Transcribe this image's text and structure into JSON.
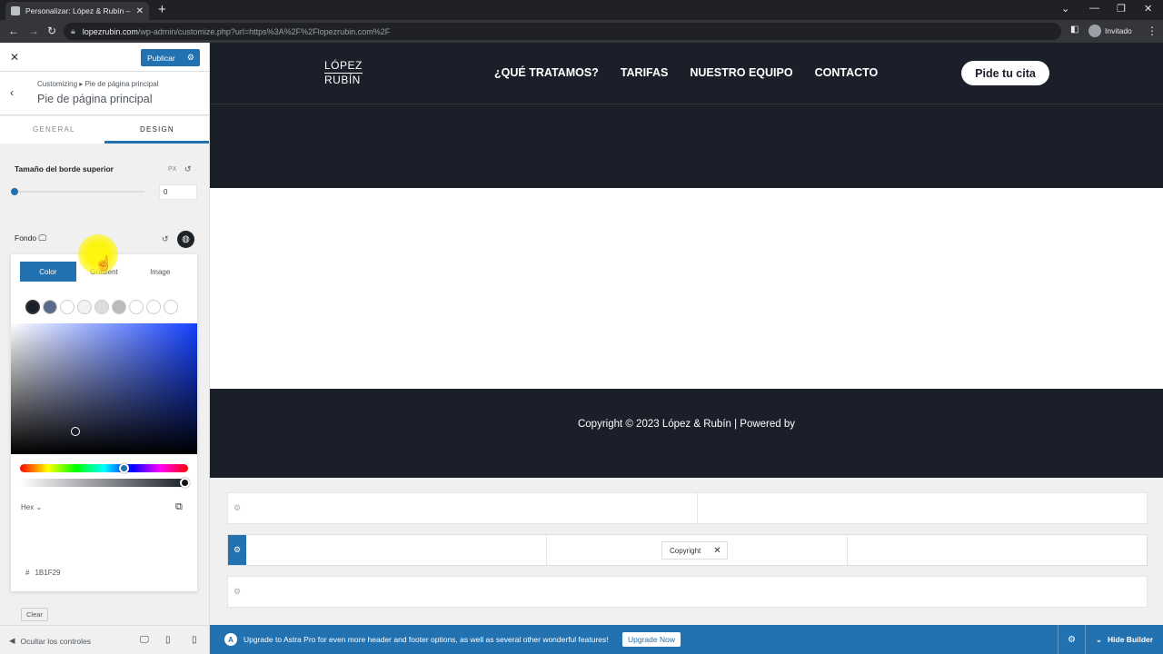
{
  "browser": {
    "tab_title": "Personalizar: López & Rubín – Ca",
    "url_host": "lopezrubin.com",
    "url_path": "/wp-admin/customize.php?url=https%3A%2F%2Flopezrubin.com%2F",
    "profile_label": "Invitado"
  },
  "customizer": {
    "publish_label": "Publicar",
    "breadcrumb": "Customizing  ▸  Pie de página principal",
    "section_title": "Pie de página principal",
    "tabs": [
      {
        "label": "GENERAL"
      },
      {
        "label": "DESIGN"
      }
    ],
    "active_tab": "DESIGN",
    "border_size": {
      "label": "Tamaño del borde superior",
      "unit": "PX",
      "value": "0"
    },
    "background": {
      "label": "Fondo"
    },
    "picker": {
      "tabs": [
        {
          "label": "Color"
        },
        {
          "label": "Gradient"
        },
        {
          "label": "Image"
        }
      ],
      "active_tab": "Color",
      "swatches": [
        "#1b1f29",
        "#5a6a8a",
        "#ffffff",
        "#f2f2f2",
        "#dddddd",
        "#bbbbbb",
        "#ffffff",
        "#ffffff",
        "#ffffff"
      ],
      "format": "Hex",
      "hex_prefix": "#",
      "hex_value": "1B1F29",
      "clear_label": "Clear"
    },
    "hide_controls_label": "Ocultar los controles"
  },
  "site": {
    "logo_line1": "LÓPEZ",
    "logo_line2": "RUBÍN",
    "nav": [
      {
        "label": "¿QUÉ TRATAMOS?"
      },
      {
        "label": "TARIFAS"
      },
      {
        "label": "NUESTRO EQUIPO"
      },
      {
        "label": "CONTACTO"
      }
    ],
    "cta_label": "Pide tu cita",
    "copyright": "Copyright © 2023 López & Rubín | Powered by"
  },
  "builder": {
    "chip_label": "Copyright"
  },
  "upsell": {
    "text": "Upgrade to Astra Pro for even more header and footer options, as well as several other wonderful features!",
    "button_label": "Upgrade Now",
    "hide_builder_label": "Hide Builder"
  },
  "colors": {
    "accent": "#2271b1",
    "dark": "#1b1f29"
  }
}
